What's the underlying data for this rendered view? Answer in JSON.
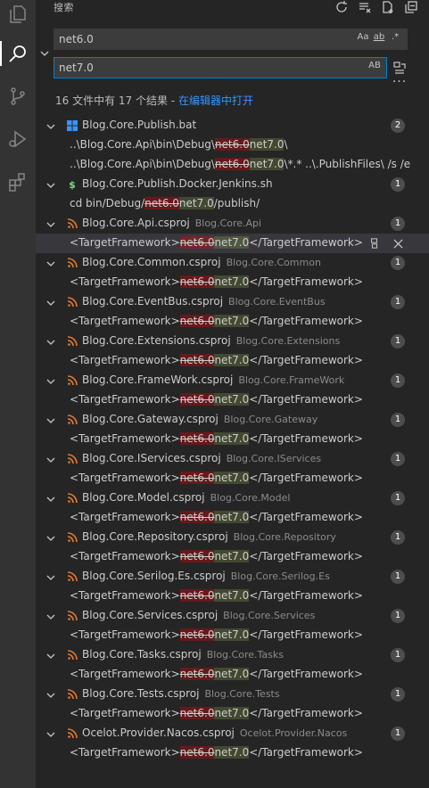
{
  "sidebar": {
    "title": "搜索",
    "title_actions": [
      "refresh-icon",
      "clear-results-icon",
      "new-search-editor-icon",
      "collapse-all-icon"
    ]
  },
  "search": {
    "query": "net6.0",
    "options": [
      "Aa",
      "ab",
      ".*"
    ],
    "replace": "net7.0",
    "replace_option": "AB",
    "more_label": "···"
  },
  "summary": {
    "text": "16 文件中有 17 个结果 - ",
    "link": "在编辑器中打开"
  },
  "results": [
    {
      "file": "Blog.Core.Publish.bat",
      "dir": "",
      "icon": "windows",
      "count": "2",
      "matches": [
        {
          "pre": "..\\Blog.Core.Api\\bin\\Debug\\",
          "del": "net6.0",
          "ins": "net7.0",
          "post": "\\"
        },
        {
          "pre": "..\\Blog.Core.Api\\bin\\Debug\\",
          "del": "net6.0",
          "ins": "net7.0",
          "post": "\\*.* ..\\.PublishFiles\\ /s /e"
        }
      ]
    },
    {
      "file": "Blog.Core.Publish.Docker.Jenkins.sh",
      "dir": "",
      "icon": "shell",
      "count": "1",
      "matches": [
        {
          "pre": "cd bin/Debug/",
          "del": "net6.0",
          "ins": "net7.0",
          "post": "/publish/"
        }
      ]
    },
    {
      "file": "Blog.Core.Api.csproj",
      "dir": "Blog.Core.Api",
      "icon": "rss",
      "count": "1",
      "matches": [
        {
          "pre": "<TargetFramework>",
          "del": "net6.0",
          "ins": "net7.0",
          "post": "</TargetFramework>",
          "selected": true
        }
      ]
    },
    {
      "file": "Blog.Core.Common.csproj",
      "dir": "Blog.Core.Common",
      "icon": "rss",
      "count": "1",
      "matches": [
        {
          "pre": "<TargetFramework>",
          "del": "net6.0",
          "ins": "net7.0",
          "post": "</TargetFramework>"
        }
      ]
    },
    {
      "file": "Blog.Core.EventBus.csproj",
      "dir": "Blog.Core.EventBus",
      "icon": "rss",
      "count": "1",
      "matches": [
        {
          "pre": "<TargetFramework>",
          "del": "net6.0",
          "ins": "net7.0",
          "post": "</TargetFramework>"
        }
      ]
    },
    {
      "file": "Blog.Core.Extensions.csproj",
      "dir": "Blog.Core.Extensions",
      "icon": "rss",
      "count": "1",
      "matches": [
        {
          "pre": "<TargetFramework>",
          "del": "net6.0",
          "ins": "net7.0",
          "post": "</TargetFramework>"
        }
      ]
    },
    {
      "file": "Blog.Core.FrameWork.csproj",
      "dir": "Blog.Core.FrameWork",
      "icon": "rss",
      "count": "1",
      "matches": [
        {
          "pre": "<TargetFramework>",
          "del": "net6.0",
          "ins": "net7.0",
          "post": "</TargetFramework>"
        }
      ]
    },
    {
      "file": "Blog.Core.Gateway.csproj",
      "dir": "Blog.Core.Gateway",
      "icon": "rss",
      "count": "1",
      "matches": [
        {
          "pre": "<TargetFramework>",
          "del": "net6.0",
          "ins": "net7.0",
          "post": "</TargetFramework>"
        }
      ]
    },
    {
      "file": "Blog.Core.IServices.csproj",
      "dir": "Blog.Core.IServices",
      "icon": "rss",
      "count": "1",
      "matches": [
        {
          "pre": "<TargetFramework>",
          "del": "net6.0",
          "ins": "net7.0",
          "post": "</TargetFramework>"
        }
      ]
    },
    {
      "file": "Blog.Core.Model.csproj",
      "dir": "Blog.Core.Model",
      "icon": "rss",
      "count": "1",
      "matches": [
        {
          "pre": "<TargetFramework>",
          "del": "net6.0",
          "ins": "net7.0",
          "post": "</TargetFramework>"
        }
      ]
    },
    {
      "file": "Blog.Core.Repository.csproj",
      "dir": "Blog.Core.Repository",
      "icon": "rss",
      "count": "1",
      "matches": [
        {
          "pre": "<TargetFramework>",
          "del": "net6.0",
          "ins": "net7.0",
          "post": "</TargetFramework>"
        }
      ]
    },
    {
      "file": "Blog.Core.Serilog.Es.csproj",
      "dir": "Blog.Core.Serilog.Es",
      "icon": "rss",
      "count": "1",
      "matches": [
        {
          "pre": "<TargetFramework>",
          "del": "net6.0",
          "ins": "net7.0",
          "post": "</TargetFramework>"
        }
      ]
    },
    {
      "file": "Blog.Core.Services.csproj",
      "dir": "Blog.Core.Services",
      "icon": "rss",
      "count": "1",
      "matches": [
        {
          "pre": "<TargetFramework>",
          "del": "net6.0",
          "ins": "net7.0",
          "post": "</TargetFramework>"
        }
      ]
    },
    {
      "file": "Blog.Core.Tasks.csproj",
      "dir": "Blog.Core.Tasks",
      "icon": "rss",
      "count": "1",
      "matches": [
        {
          "pre": "<TargetFramework>",
          "del": "net6.0",
          "ins": "net7.0",
          "post": "</TargetFramework>"
        }
      ]
    },
    {
      "file": "Blog.Core.Tests.csproj",
      "dir": "Blog.Core.Tests",
      "icon": "rss",
      "count": "1",
      "matches": [
        {
          "pre": "<TargetFramework>",
          "del": "net6.0",
          "ins": "net7.0",
          "post": "</TargetFramework>"
        }
      ]
    },
    {
      "file": "Ocelot.Provider.Nacos.csproj",
      "dir": "Ocelot.Provider.Nacos",
      "icon": "rss",
      "count": "1",
      "matches": [
        {
          "pre": "<TargetFramework>",
          "del": "net6.0",
          "ins": "net7.0",
          "post": "</TargetFramework>"
        }
      ]
    }
  ],
  "colors": {
    "accent": "#007fd4",
    "link": "#3794ff",
    "rss_icon": "#e37933",
    "shell_icon": "#89d185",
    "windows_icon": "#3794ff"
  }
}
